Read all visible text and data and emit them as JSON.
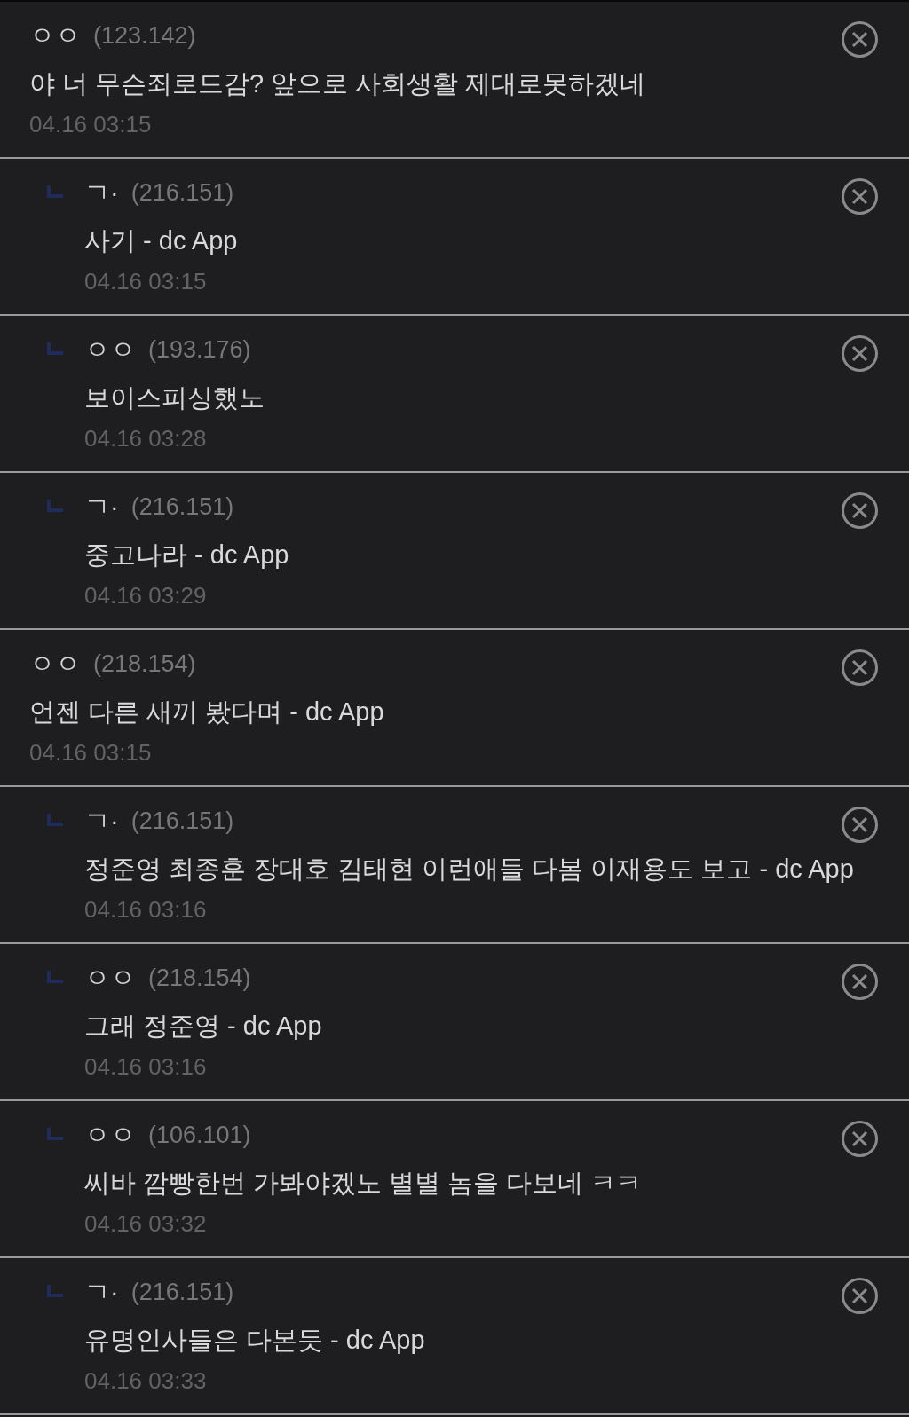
{
  "comments": [
    {
      "kind": "comment",
      "nickname": "ㅇㅇ",
      "ip": "(123.142)",
      "text": "야 너 무슨죄로드감? 앞으로 사회생활 제대로못하겠네",
      "date": "04.16 03:15"
    },
    {
      "kind": "reply",
      "nickname": "ㄱ·",
      "ip": "(216.151)",
      "text": "사기 - dc App",
      "date": "04.16 03:15"
    },
    {
      "kind": "reply",
      "nickname": "ㅇㅇ",
      "ip": "(193.176)",
      "text": "보이스피싱했노",
      "date": "04.16 03:28"
    },
    {
      "kind": "reply",
      "nickname": "ㄱ·",
      "ip": "(216.151)",
      "text": "중고나라 - dc App",
      "date": "04.16 03:29"
    },
    {
      "kind": "comment",
      "nickname": "ㅇㅇ",
      "ip": "(218.154)",
      "text": "언젠 다른 새끼 봤다며 - dc App",
      "date": "04.16 03:15"
    },
    {
      "kind": "reply",
      "nickname": "ㄱ·",
      "ip": "(216.151)",
      "text": "정준영 최종훈 장대호 김태현 이런애들 다봄 이재용도 보고 - dc App",
      "date": "04.16 03:16"
    },
    {
      "kind": "reply",
      "nickname": "ㅇㅇ",
      "ip": "(218.154)",
      "text": "그래 정준영 - dc App",
      "date": "04.16 03:16"
    },
    {
      "kind": "reply",
      "nickname": "ㅇㅇ",
      "ip": "(106.101)",
      "text": "씨바 깜빵한번 가봐야겠노 별별 놈을 다보네 ㅋㅋ",
      "date": "04.16 03:32"
    },
    {
      "kind": "reply",
      "nickname": "ㄱ·",
      "ip": "(216.151)",
      "text": "유명인사들은 다본듯 - dc App",
      "date": "04.16 03:33"
    }
  ]
}
